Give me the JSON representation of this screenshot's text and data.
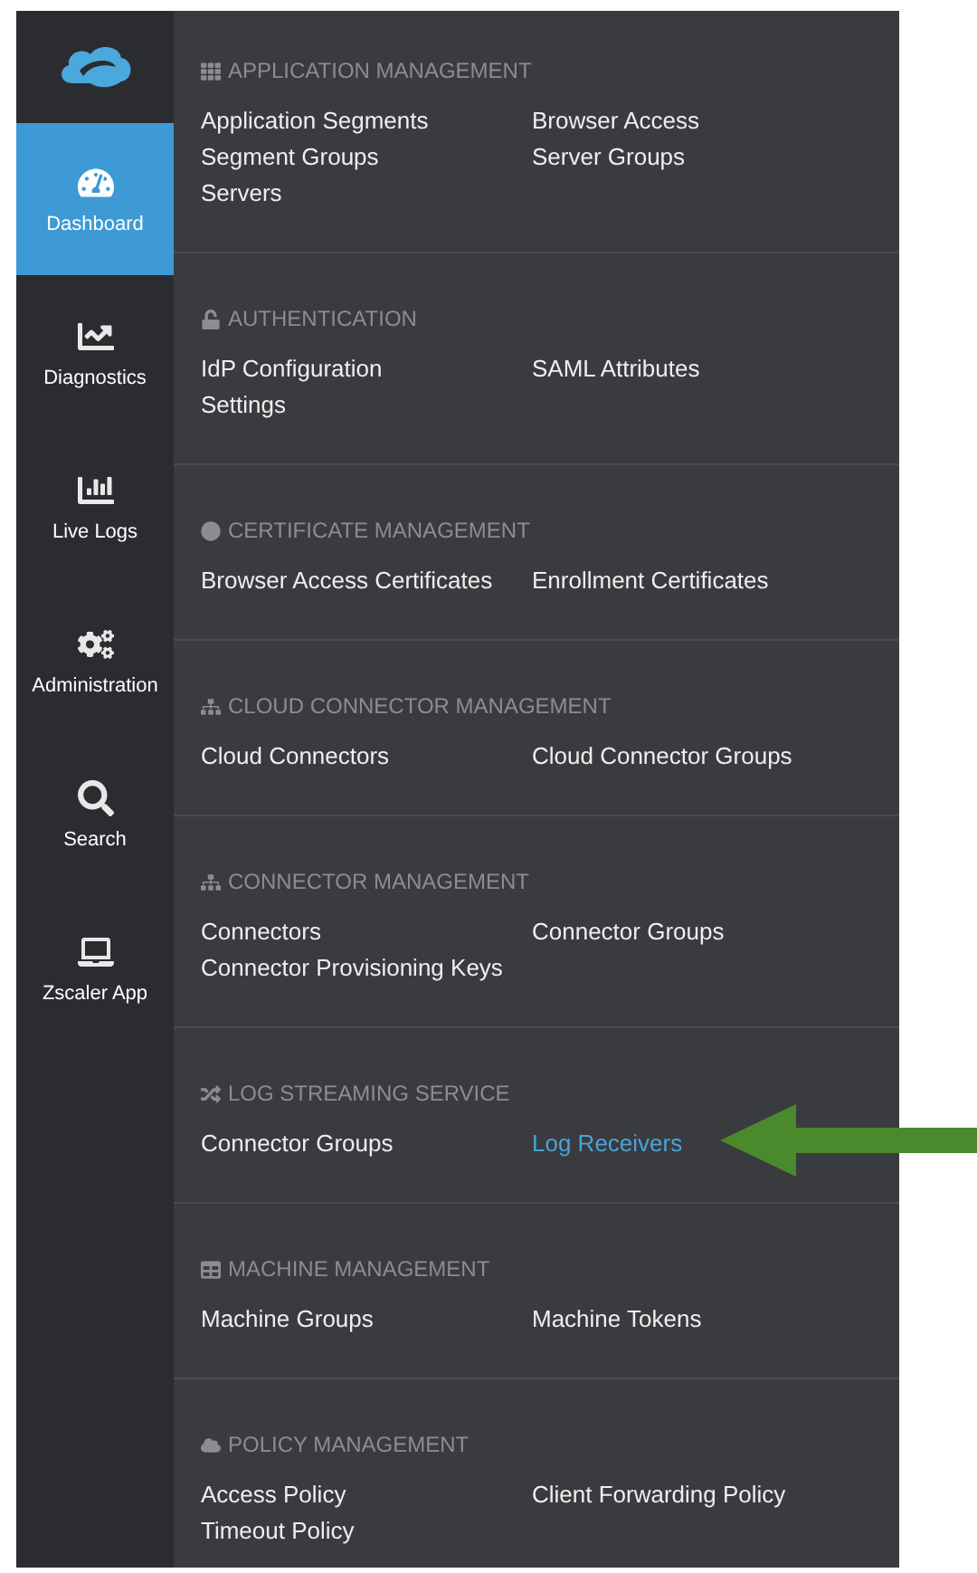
{
  "sidebar": {
    "items": [
      {
        "label": "Dashboard",
        "selected": true
      },
      {
        "label": "Diagnostics",
        "selected": false
      },
      {
        "label": "Live Logs",
        "selected": false
      },
      {
        "label": "Administration",
        "selected": false
      },
      {
        "label": "Search",
        "selected": false
      },
      {
        "label": "Zscaler App",
        "selected": false
      }
    ]
  },
  "menu": {
    "sections": [
      {
        "title": "APPLICATION MANAGEMENT",
        "items": [
          {
            "label": "Application Segments",
            "selected": false
          },
          {
            "label": "Browser Access",
            "selected": false
          },
          {
            "label": "Segment Groups",
            "selected": false
          },
          {
            "label": "Server Groups",
            "selected": false
          },
          {
            "label": "Servers",
            "selected": false
          }
        ]
      },
      {
        "title": "AUTHENTICATION",
        "items": [
          {
            "label": "IdP Configuration",
            "selected": false
          },
          {
            "label": "SAML Attributes",
            "selected": false
          },
          {
            "label": "Settings",
            "selected": false
          }
        ]
      },
      {
        "title": "CERTIFICATE MANAGEMENT",
        "items": [
          {
            "label": "Browser Access Certificates",
            "selected": false
          },
          {
            "label": "Enrollment Certificates",
            "selected": false
          }
        ]
      },
      {
        "title": "CLOUD CONNECTOR MANAGEMENT",
        "items": [
          {
            "label": "Cloud Connectors",
            "selected": false
          },
          {
            "label": "Cloud Connector Groups",
            "selected": false
          }
        ]
      },
      {
        "title": "CONNECTOR MANAGEMENT",
        "items": [
          {
            "label": "Connectors",
            "selected": false
          },
          {
            "label": "Connector Groups",
            "selected": false
          },
          {
            "label": "Connector Provisioning Keys",
            "selected": false
          }
        ]
      },
      {
        "title": "LOG STREAMING SERVICE",
        "items": [
          {
            "label": "Connector Groups",
            "selected": false
          },
          {
            "label": "Log Receivers",
            "selected": true
          }
        ]
      },
      {
        "title": "MACHINE MANAGEMENT",
        "items": [
          {
            "label": "Machine Groups",
            "selected": false
          },
          {
            "label": "Machine Tokens",
            "selected": false
          }
        ]
      },
      {
        "title": "POLICY MANAGEMENT",
        "items": [
          {
            "label": "Access Policy",
            "selected": false
          },
          {
            "label": "Client Forwarding Policy",
            "selected": false
          },
          {
            "label": "Timeout Policy",
            "selected": false
          }
        ]
      }
    ]
  }
}
